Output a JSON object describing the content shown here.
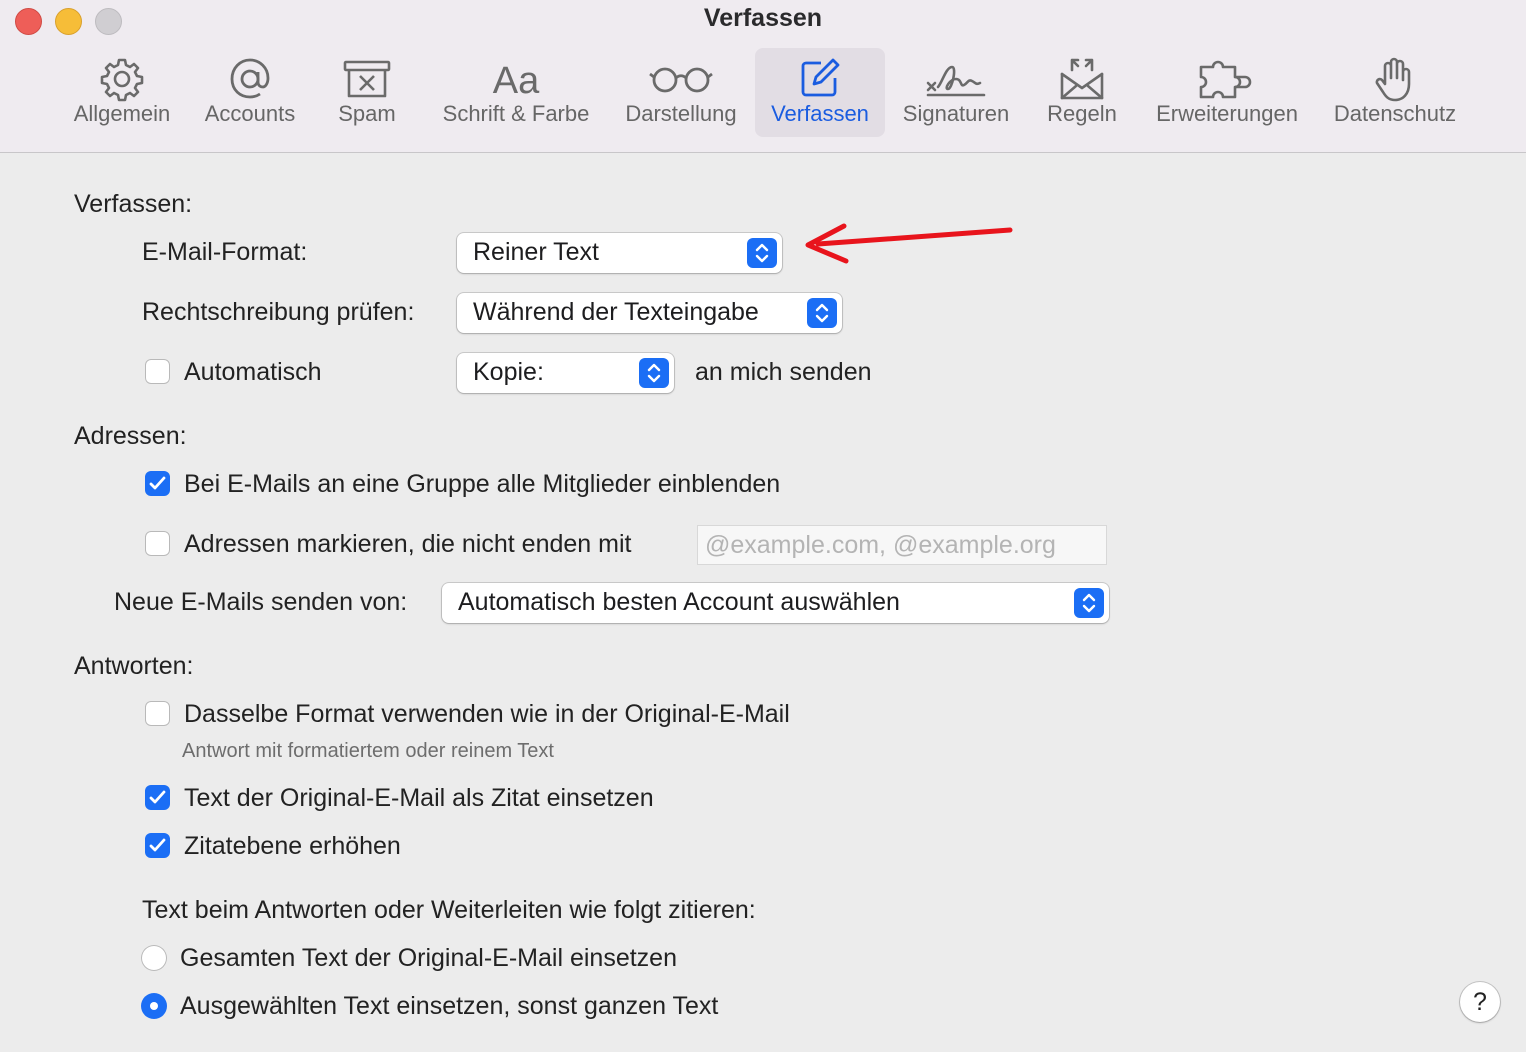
{
  "window": {
    "title": "Verfassen"
  },
  "toolbar": {
    "tabs": [
      {
        "label": "Allgemein",
        "icon": "gear-icon"
      },
      {
        "label": "Accounts",
        "icon": "at-icon"
      },
      {
        "label": "Spam",
        "icon": "junk-tray-icon"
      },
      {
        "label": "Schrift & Farbe",
        "icon": "font-icon"
      },
      {
        "label": "Darstellung",
        "icon": "glasses-icon"
      },
      {
        "label": "Verfassen",
        "icon": "compose-icon",
        "active": true
      },
      {
        "label": "Signaturen",
        "icon": "signature-icon"
      },
      {
        "label": "Regeln",
        "icon": "rules-envelope-icon"
      },
      {
        "label": "Erweiterungen",
        "icon": "puzzle-icon"
      },
      {
        "label": "Datenschutz",
        "icon": "hand-icon"
      }
    ]
  },
  "compose": {
    "heading": "Verfassen:",
    "email_format_label": "E-Mail-Format:",
    "email_format_value": "Reiner Text",
    "spellcheck_label": "Rechtschreibung prüfen:",
    "spellcheck_value": "Während der Texteingabe",
    "auto_label": "Automatisch",
    "auto_checked": false,
    "copy_value": "Kopie:",
    "copy_suffix": "an mich senden"
  },
  "addresses": {
    "heading": "Adressen:",
    "show_group_members_label": "Bei E-Mails an eine Gruppe alle Mitglieder einblenden",
    "show_group_members_checked": true,
    "mark_addresses_label": "Adressen markieren, die nicht enden mit",
    "mark_addresses_checked": false,
    "mark_addresses_placeholder": "@example.com, @example.org",
    "send_from_label": "Neue E-Mails senden von:",
    "send_from_value": "Automatisch besten Account auswählen"
  },
  "replies": {
    "heading": "Antworten:",
    "same_format_label": "Dasselbe Format verwenden wie in der Original-E-Mail",
    "same_format_checked": false,
    "same_format_sub": "Antwort mit formatiertem oder reinem Text",
    "quote_label": "Text der Original-E-Mail als Zitat einsetzen",
    "quote_checked": true,
    "increase_quote_label": "Zitatebene erhöhen",
    "increase_quote_checked": true,
    "quote_mode_heading": "Text beim Antworten oder Weiterleiten wie folgt zitieren:",
    "quote_all_label": "Gesamten Text der Original-E-Mail einsetzen",
    "quote_selected_label": "Ausgewählten Text einsetzen, sonst ganzen Text",
    "quote_mode_selected": "selected"
  },
  "help": {
    "label": "?"
  },
  "colors": {
    "accent": "#1b6ef5",
    "annotation_arrow": "#e8141c",
    "active_tab_text": "#1a5ce0"
  }
}
